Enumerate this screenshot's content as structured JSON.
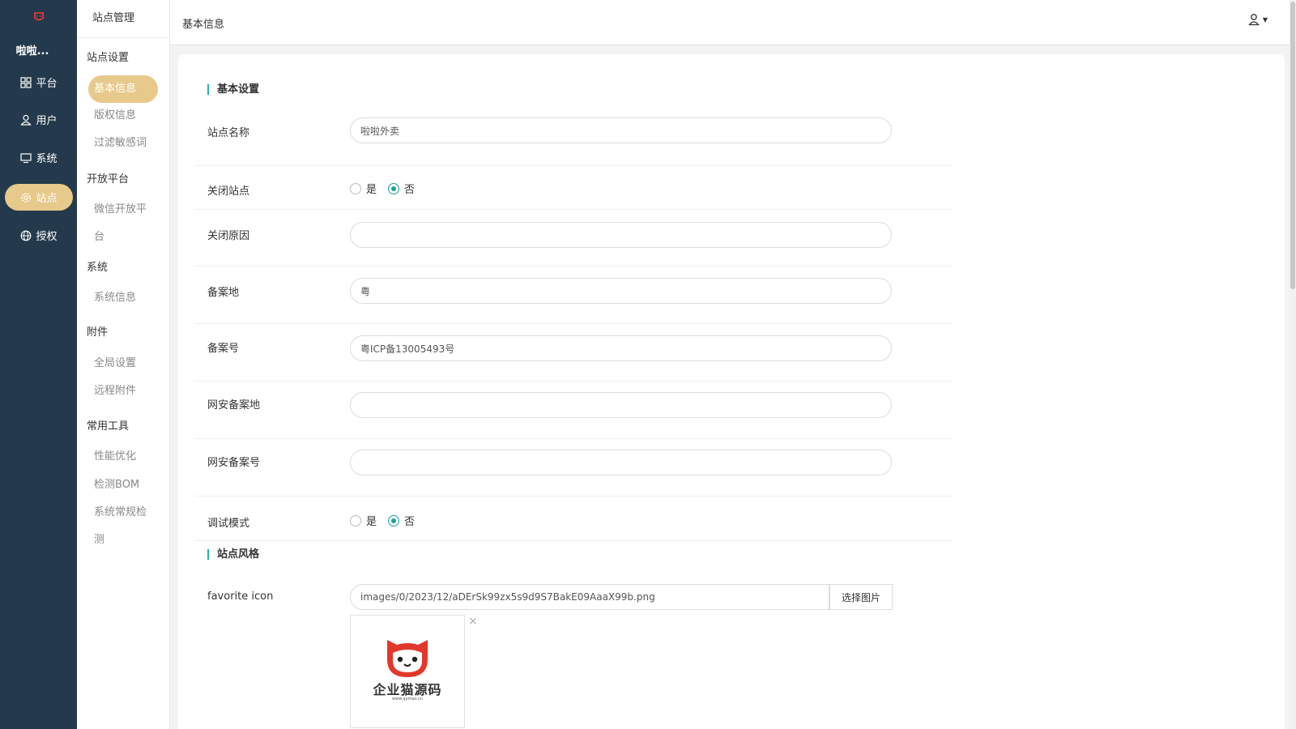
{
  "rail": {
    "brand": "啦啦...",
    "items": [
      {
        "label": "平台",
        "icon": "grid-icon"
      },
      {
        "label": "用户",
        "icon": "user-icon"
      },
      {
        "label": "系统",
        "icon": "monitor-icon"
      },
      {
        "label": "站点",
        "icon": "gear-icon"
      },
      {
        "label": "授权",
        "icon": "globe-icon"
      }
    ]
  },
  "sidebar": {
    "title": "站点管理",
    "groups": [
      {
        "label": "站点设置",
        "items": [
          "基本信息",
          "版权信息",
          "过滤敏感词"
        ]
      },
      {
        "label": "开放平台",
        "items": [
          "微信开放平",
          "台"
        ]
      },
      {
        "label": "系统",
        "items": [
          "系统信息"
        ]
      },
      {
        "label": "附件",
        "items": [
          "全局设置",
          "远程附件"
        ]
      },
      {
        "label": "常用工具",
        "items": [
          "性能优化",
          "检测BOM",
          "系统常规检",
          "测"
        ]
      }
    ]
  },
  "header": {
    "title": "基本信息"
  },
  "form": {
    "section_basic": "基本设置",
    "site_name_label": "站点名称",
    "site_name_value": "啦啦外卖",
    "close_site_label": "关闭站点",
    "close_reason_label": "关闭原因",
    "close_reason_value": "",
    "beian_place_label": "备案地",
    "beian_place_value": "粤",
    "beian_no_label": "备案号",
    "beian_no_value": "粤ICP备13005493号",
    "police_place_label": "网安备案地",
    "police_place_value": "",
    "police_no_label": "网安备案号",
    "police_no_value": "",
    "debug_label": "调试模式",
    "yes": "是",
    "no": "否",
    "section_style": "站点风格",
    "favicon_label": "favorite icon",
    "favicon_value": "images/0/2023/12/aDErSk99zx5s9d9S7BakE09AaaX99b.png",
    "pick_image": "选择图片",
    "preview_logo_text": "企业猫源码",
    "preview_logo_sub": "www.qymao.cn"
  },
  "colors": {
    "rail_bg": "#243a4c",
    "accent": "#e7c98b",
    "radio": "#1aa39a"
  }
}
